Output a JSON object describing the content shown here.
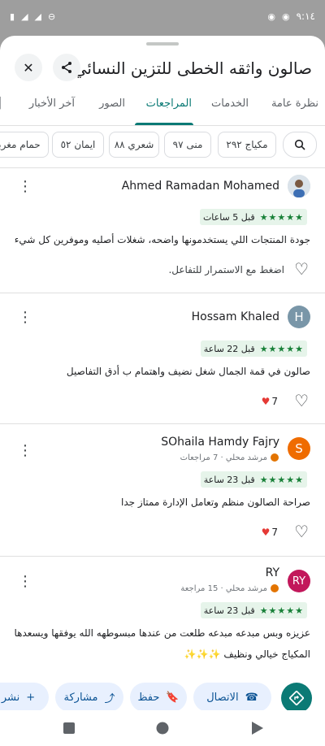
{
  "status": {
    "time": "٩:١٤"
  },
  "header": {
    "title": "صالون واثقه الخطى للتزين النسائي",
    "share_icon": "share-icon",
    "close_icon": "close-icon"
  },
  "tabs": [
    "نظرة عامة",
    "الخدمات",
    "المراجعات",
    "الصور",
    "آخر الأخبار"
  ],
  "chips": {
    "search_icon": "search-icon",
    "items": [
      "مكياج ٢٩٢",
      "منى ٩٧",
      "شعري ٨٨",
      "ايمان ٥٢",
      "حمام مغربي"
    ]
  },
  "reviews": [
    {
      "name": "Ahmed Ramadan Mohamed",
      "stars": "★★★★★",
      "when": "قبل 5 ساعات",
      "text": "جودة المنتجات اللي يستخدمونها واضحه، شغلات أصليه وموفرين كل شيء",
      "hint": "اضغط مع الاستمرار للتفاعل."
    },
    {
      "name": "Hossam Khaled",
      "initial": "H",
      "stars": "★★★★★",
      "when": "قبل 22 ساعة",
      "text": "صالون في قمة الجمال شغل نضيف واهتمام ب أدق التفاصيل",
      "likes": "7"
    },
    {
      "name": "SOhaila Hamdy Fajry",
      "initial": "S",
      "sub": "مرشد محلي · 7 مراجعات",
      "stars": "★★★★★",
      "when": "قبل 23 ساعة",
      "text": "صراحة الصالون منظم وتعامل الإدارة ممتاز جدا",
      "likes": "7"
    },
    {
      "name": "RY",
      "initial": "RY",
      "sub": "مرشد محلي · 15 مراجعة",
      "stars": "★★★★★",
      "when": "قبل 23 ساعة",
      "text": "عزيزه وبس مبدعه مبدعه طلعت من عندها مبسوطهه الله يوفقها ويسعدها",
      "text2": "المكياج خيالي ونظيف ✨✨✨"
    }
  ],
  "actions": {
    "directions_icon": "directions-icon",
    "call": "الاتصال",
    "save": "حفظ",
    "share": "مشاركة",
    "post": "نشر صورة"
  },
  "colors": {
    "accent": "#0b7a75",
    "stars": "#188038"
  }
}
